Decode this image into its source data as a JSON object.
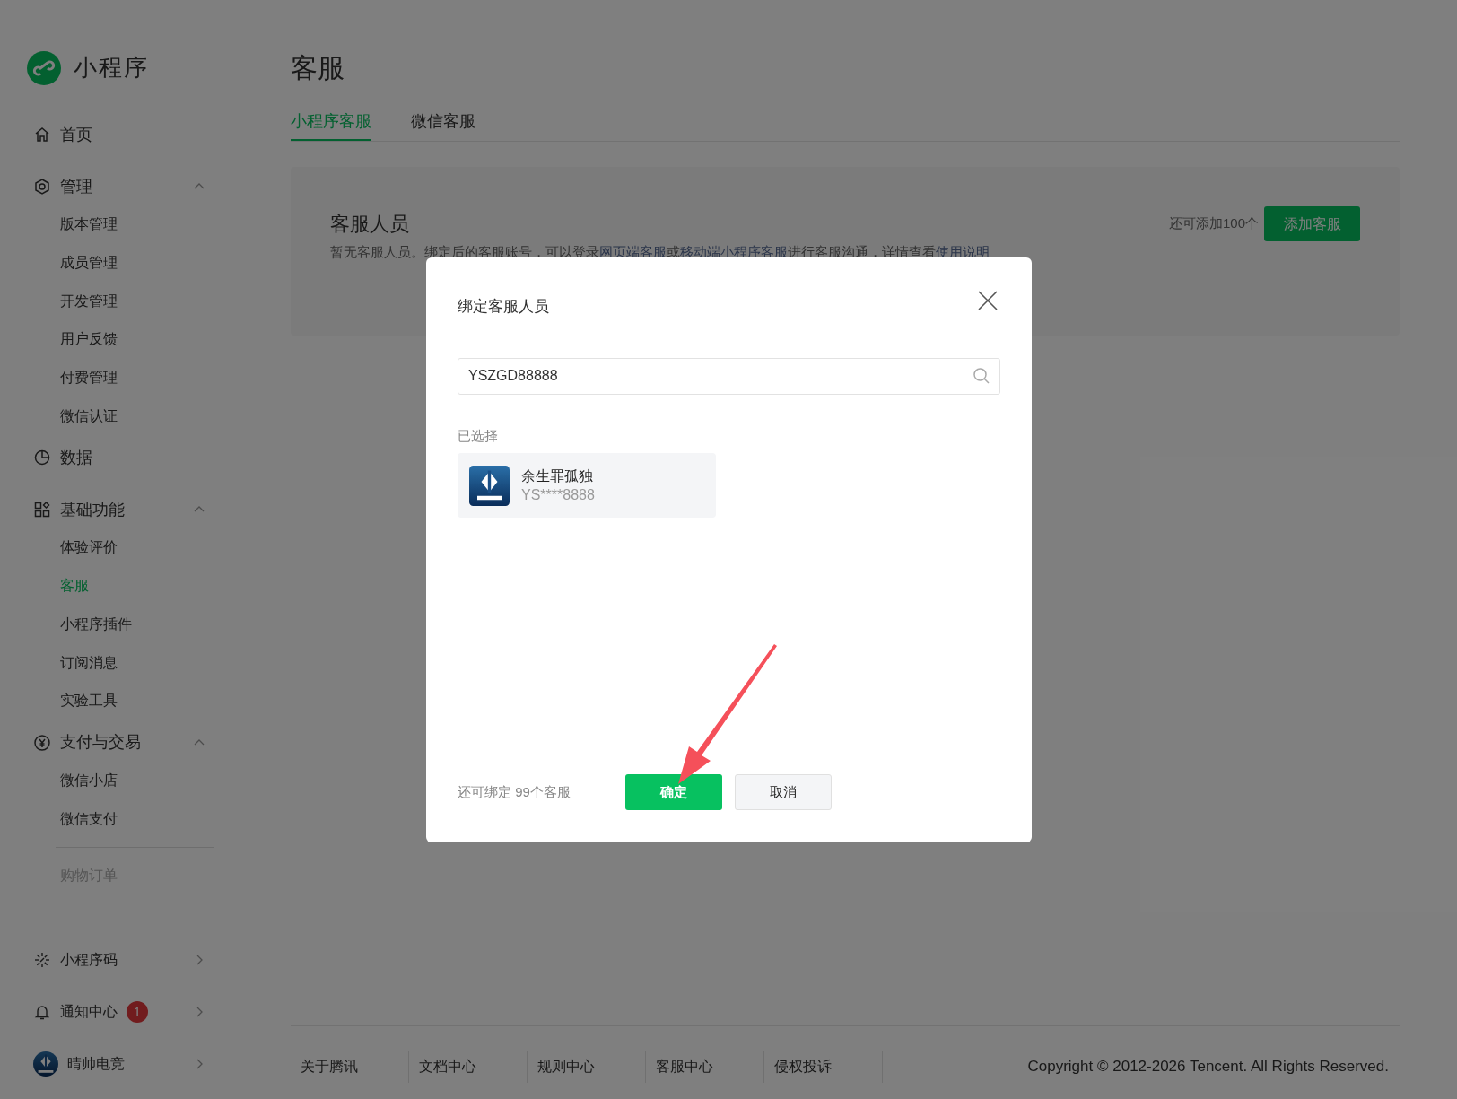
{
  "sidebar": {
    "logo_text": "小程序",
    "items": [
      {
        "kind": "link",
        "label": "首页",
        "selected": false
      },
      {
        "kind": "group",
        "label": "管理",
        "selected": false,
        "expanded": true,
        "children": [
          {
            "label": "版本管理",
            "selected": false
          },
          {
            "label": "成员管理",
            "selected": false
          },
          {
            "label": "开发管理",
            "selected": false
          },
          {
            "label": "用户反馈",
            "selected": false
          },
          {
            "label": "付费管理",
            "selected": false
          },
          {
            "label": "微信认证",
            "selected": false
          }
        ]
      },
      {
        "kind": "link",
        "label": "数据",
        "selected": false
      },
      {
        "kind": "group",
        "label": "基础功能",
        "selected": false,
        "expanded": true,
        "children": [
          {
            "label": "体验评价",
            "selected": false
          },
          {
            "label": "客服",
            "selected": true
          },
          {
            "label": "小程序插件",
            "selected": false
          },
          {
            "label": "订阅消息",
            "selected": false
          },
          {
            "label": "实验工具",
            "selected": false
          }
        ]
      },
      {
        "kind": "group",
        "label": "支付与交易",
        "selected": false,
        "expanded": true,
        "children": [
          {
            "label": "微信小店",
            "selected": false,
            "disabled": false
          },
          {
            "label": "微信支付",
            "selected": false,
            "disabled": false
          },
          {
            "kind": "divider"
          },
          {
            "label": "购物订单",
            "selected": false,
            "disabled": true
          }
        ]
      }
    ],
    "bottom_items": [
      {
        "kind": "code",
        "label": "小程序码"
      },
      {
        "kind": "notice",
        "label": "通知中心",
        "badge": "1"
      },
      {
        "kind": "account",
        "label": "晴帅电竞"
      }
    ]
  },
  "page": {
    "title": "客服",
    "tabs": [
      {
        "label": "小程序客服",
        "selected": true
      },
      {
        "label": "微信客服",
        "selected": false
      }
    ],
    "card": {
      "title": "客服人员",
      "description": [
        {
          "kind": "text",
          "text": "暂无客服人员。绑定后的客服账号，可以登录"
        },
        {
          "kind": "link",
          "text": "网页端客服"
        },
        {
          "kind": "text",
          "text": "或"
        },
        {
          "kind": "link",
          "text": "移动端小程序客服"
        },
        {
          "kind": "text",
          "text": "进行客服沟通，详情查看"
        },
        {
          "kind": "link",
          "text": "使用说明"
        }
      ],
      "quota": "还可添加100个",
      "button": "添加客服"
    }
  },
  "dialog": {
    "title": "绑定客服人员",
    "search": {
      "value": "YSZGD88888"
    },
    "selected_label": "已选择",
    "selected_users": [
      {
        "name": "余生罪孤独",
        "id": "YS****8888"
      }
    ],
    "remaining": "还可绑定 99个客服",
    "buttons": [
      {
        "kind": "primary",
        "label": "确定"
      },
      {
        "kind": "default",
        "label": "取消"
      }
    ]
  },
  "footer": {
    "links": [
      "关于腾讯",
      "文档中心",
      "规则中心",
      "客服中心",
      "侵权投诉"
    ],
    "copyright": "Copyright © 2012-2026 Tencent. All Rights Reserved."
  }
}
